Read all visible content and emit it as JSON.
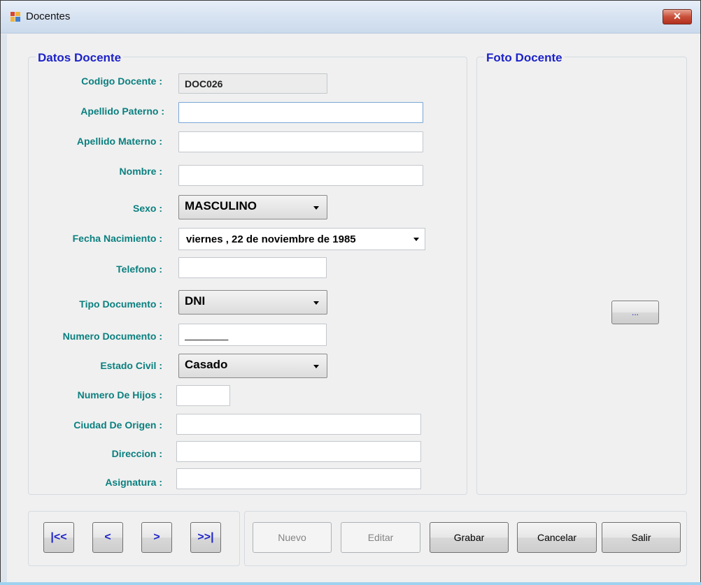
{
  "window": {
    "title": "Docentes",
    "close_label": "✕"
  },
  "datos": {
    "legend": "Datos Docente",
    "labels": {
      "codigo": "Codigo Docente :",
      "apellido_paterno": "Apellido Paterno :",
      "apellido_materno": "Apellido Materno :",
      "nombre": "Nombre :",
      "sexo": "Sexo :",
      "fecha_nacimiento": "Fecha Nacimiento :",
      "telefono": "Telefono :",
      "tipo_documento": "Tipo Documento :",
      "numero_documento": "Numero Documento :",
      "estado_civil": "Estado Civil :",
      "numero_hijos": "Numero De Hijos :",
      "ciudad_origen": "Ciudad De Origen :",
      "direccion": "Direccion  :",
      "asignatura": "Asignatura  :"
    },
    "values": {
      "codigo": "DOC026",
      "apellido_paterno": "",
      "apellido_materno": "",
      "nombre": "",
      "sexo": "MASCULINO",
      "fecha_nacimiento": "viernes  , 22 de noviembre de 1985",
      "telefono": "",
      "tipo_documento": "DNI",
      "numero_documento": "________",
      "estado_civil": "Casado",
      "numero_hijos": "",
      "ciudad_origen": "",
      "direccion": "",
      "asignatura": ""
    }
  },
  "foto": {
    "legend": "Foto Docente",
    "browse_label": "..."
  },
  "nav_buttons": {
    "first": "|<<",
    "prev": "<",
    "next": ">",
    "last": ">>|"
  },
  "actions": {
    "nuevo": "Nuevo",
    "editar": "Editar",
    "grabar": "Grabar",
    "cancelar": "Cancelar",
    "salir": "Salir"
  },
  "colors": {
    "legend": "#1d23c8",
    "label": "#0b7f7f"
  }
}
